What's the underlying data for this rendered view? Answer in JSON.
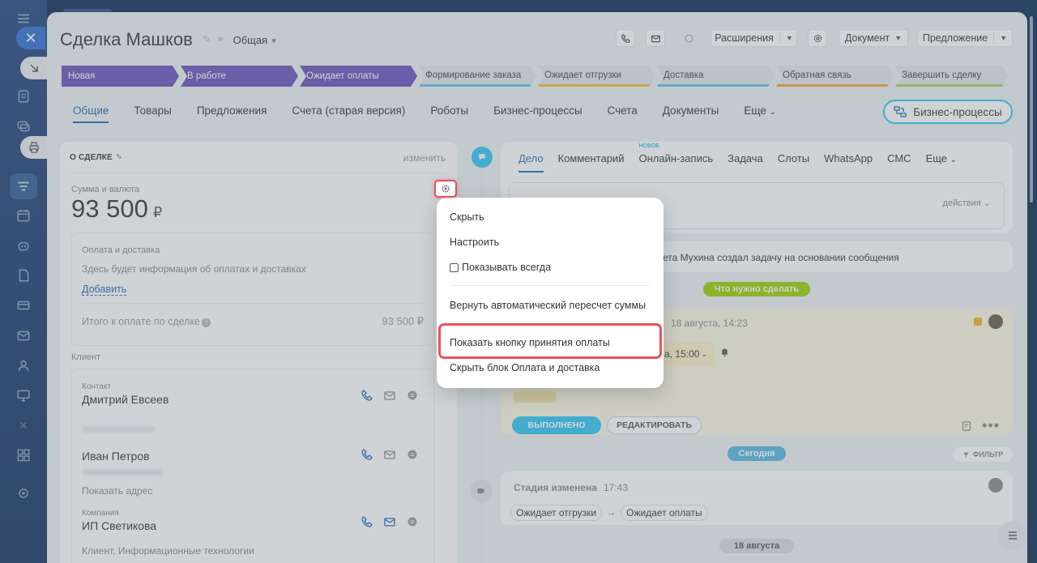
{
  "deal": {
    "title": "Сделка Машков",
    "category": "Общая"
  },
  "header": {
    "extensions": "Расширения",
    "document": "Документ",
    "offer": "Предложение"
  },
  "stages": [
    "Новая",
    "В работе",
    "Ожидает оплаты",
    "Формирование заказа",
    "Ожидает отгрузки",
    "Доставка",
    "Обратная связь",
    "Завершить сделку"
  ],
  "tabs": [
    "Общие",
    "Товары",
    "Предложения",
    "Счета (старая версия)",
    "Роботы",
    "Бизнес-процессы",
    "Счета",
    "Документы",
    "Еще"
  ],
  "bp_button": "Бизнес-процессы",
  "about": {
    "heading": "О СДЕЛКЕ",
    "edit": "изменить",
    "sum_label": "Сумма и валюта",
    "sum_value": "93 500",
    "currency": "₽",
    "payment": {
      "title": "Оплата и доставка",
      "desc": "Здесь будет информация об оплатах и доставках",
      "add": "Добавить",
      "total_label": "Итого к оплате по сделке",
      "total_value": "93 500 ₽"
    },
    "client_label": "Клиент",
    "contact_label": "Контакт",
    "contact1": "Дмитрий Евсеев",
    "contact2": "Иван Петров",
    "show_address": "Показать адрес",
    "company_label": "Компания",
    "company": "ИП Светикова",
    "company_desc": "Клиент, Информационные технологии"
  },
  "activity_tabs": {
    "t1": "Дело",
    "t2": "Комментарий",
    "t3": "Онлайн-запись",
    "new_badge": "НОВОЕ",
    "t4": "Задача",
    "t5": "Слоты",
    "t6": "WhatsApp",
    "t7": "СМС",
    "t8": "Еще"
  },
  "actions_label": "действия",
  "feed_text": "ета Мухина создал задачу на основании сообщения",
  "todo_pill": "Что нужно сделать",
  "task": {
    "date": "18 августа, 14:23",
    "deadline": "а, 15:00",
    "done": "ВЫПОЛНЕНО",
    "edit": "РЕДАКТИРОВАТЬ"
  },
  "today_pill": "Сегодня",
  "filter": "ФИЛЬТР",
  "history": {
    "title": "Стадия изменена",
    "time": "17:43",
    "from": "Ожидает отгрузки",
    "to": "Ожидает оплаты"
  },
  "aug_pill": "18 августа",
  "menu": {
    "hide": "Скрыть",
    "configure": "Настроить",
    "always_show": "Показывать всегда",
    "restore_recalc": "Вернуть автоматический пересчет суммы",
    "show_payment_button": "Показать кнопку принятия оплаты",
    "hide_payment_block": "Скрыть блок Оплата и доставка"
  },
  "colors": {
    "stage_done": "#6b4fbb",
    "accent": "#2fc6f6",
    "highlight": "#e8525b",
    "link": "#2067b0"
  }
}
